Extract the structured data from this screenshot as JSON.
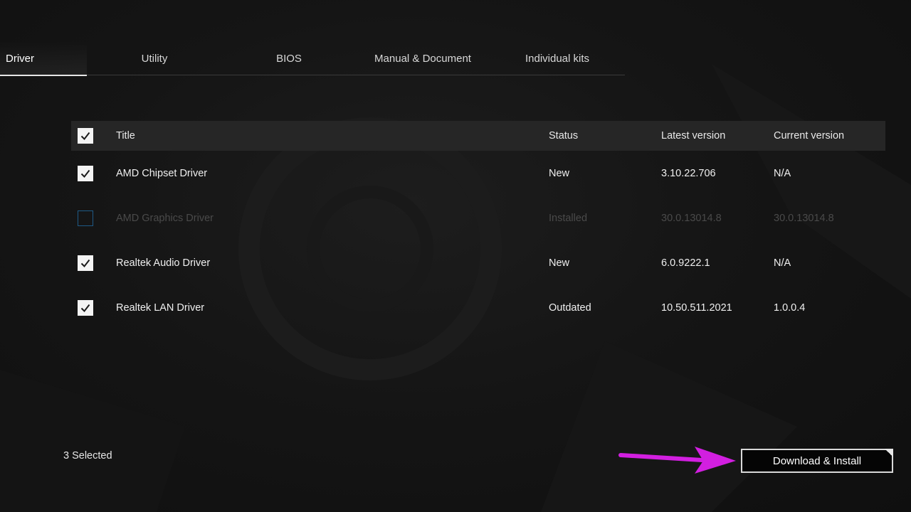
{
  "tabs": [
    {
      "label": "Driver",
      "active": true
    },
    {
      "label": "Utility",
      "active": false
    },
    {
      "label": "BIOS",
      "active": false
    },
    {
      "label": "Manual & Document",
      "active": false
    },
    {
      "label": "Individual kits",
      "active": false
    }
  ],
  "table": {
    "header": {
      "select_all_checked": true,
      "title": "Title",
      "status": "Status",
      "latest_version": "Latest version",
      "current_version": "Current version"
    },
    "rows": [
      {
        "checked": true,
        "enabled": true,
        "title": "AMD Chipset Driver",
        "status": "New",
        "latest_version": "3.10.22.706",
        "current_version": "N/A"
      },
      {
        "checked": false,
        "enabled": false,
        "title": "AMD Graphics Driver",
        "status": "Installed",
        "latest_version": "30.0.13014.8",
        "current_version": "30.0.13014.8"
      },
      {
        "checked": true,
        "enabled": true,
        "title": "Realtek Audio Driver",
        "status": "New",
        "latest_version": "6.0.9222.1",
        "current_version": "N/A"
      },
      {
        "checked": true,
        "enabled": true,
        "title": "Realtek LAN Driver",
        "status": "Outdated",
        "latest_version": "10.50.511.2021",
        "current_version": "1.0.0.4"
      }
    ]
  },
  "footer": {
    "selected_count": "3 Selected",
    "download_button": "Download & Install"
  },
  "colors": {
    "background": "#121212",
    "header_bg": "#262626",
    "checkbox_checked": "#f4f4f4",
    "checkbox_unchecked_border": "#1e5a86",
    "annotation_arrow": "#d21fe0",
    "disabled_text": "#4a4a4a"
  },
  "icons": {
    "checkbox_check": "check-icon",
    "annotation": "arrow-right-icon"
  }
}
